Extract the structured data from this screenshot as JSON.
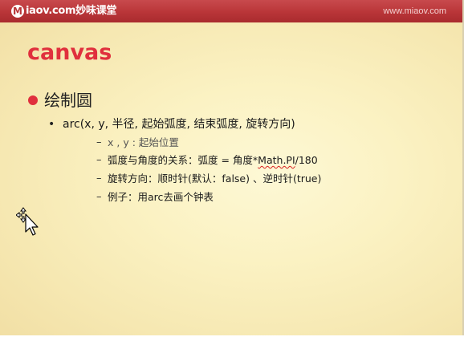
{
  "header": {
    "logo_mark": "M",
    "logo_text": "iaov.com妙味课堂",
    "site_url": "www.miaov.com"
  },
  "slide": {
    "title": "canvas",
    "bullet": "绘制圆",
    "signature": "arc(x, y, 半径, 起始弧度, 结束弧度, 旋转方向)",
    "sub_items": [
      {
        "text": "x , y :  起始位置"
      },
      {
        "prefix": "弧度与角度的关系：弧度 = 角度*",
        "highlight": "Math.PI",
        "suffix": "/180"
      },
      {
        "text": "旋转方向：顺时针(默认：false) 、逆时针(true)"
      },
      {
        "text": "例子：用arc去画个钟表"
      }
    ]
  },
  "colors": {
    "header_red": "#b93538",
    "title_red": "#e0303d",
    "slide_bg": "#fbf2c3"
  },
  "icons": {
    "cursor": "move-cursor-icon"
  }
}
